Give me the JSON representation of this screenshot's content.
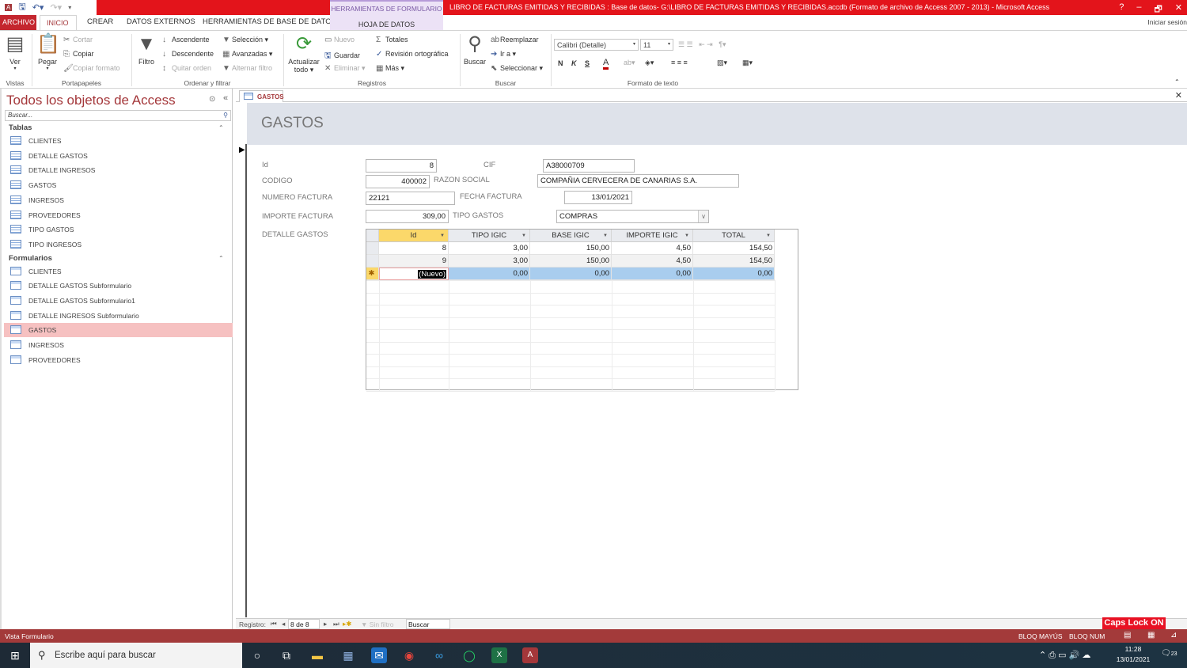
{
  "window": {
    "title": "LIBRO DE FACTURAS EMITIDAS Y RECIBIDAS : Base de datos- G:\\LIBRO DE FACTURAS EMITIDAS Y RECIBIDAS.accdb (Formato de archivo de Access 2007 - 2013) -  Microsoft Access",
    "context_tab_group": "HERRAMIENTAS DE FORMULARIO",
    "context_tab": "HOJA DE DATOS",
    "help": "?",
    "minimize": "–",
    "restore": "🗗",
    "close": "✕",
    "sign_in": "Iniciar sesión"
  },
  "tabs": [
    "ARCHIVO",
    "INICIO",
    "CREAR",
    "DATOS EXTERNOS",
    "HERRAMIENTAS DE BASE DE DATOS"
  ],
  "ribbon": {
    "vistas": {
      "label": "Vistas",
      "ver": "Ver"
    },
    "portapapeles": {
      "label": "Portapapeles",
      "pegar": "Pegar",
      "cortar": "Cortar",
      "copiar": "Copiar",
      "copiar_formato": "Copiar formato"
    },
    "ordenar": {
      "label": "Ordenar y filtrar",
      "filtro": "Filtro",
      "ascendente": "Ascendente",
      "descendente": "Descendente",
      "quitar_orden": "Quitar orden",
      "seleccion": "Selección ▾",
      "avanzadas": "Avanzadas ▾",
      "alternar_filtro": "Alternar filtro"
    },
    "registros": {
      "label": "Registros",
      "actualizar": "Actualizar",
      "todo": "todo ▾",
      "nuevo": "Nuevo",
      "guardar": "Guardar",
      "eliminar": "Eliminar ▾",
      "totales": "Totales",
      "revision": "Revisión ortográfica",
      "mas": "Más ▾"
    },
    "buscar": {
      "label": "Buscar",
      "buscar": "Buscar",
      "reemplazar": "Reemplazar",
      "ir_a": "Ir a ▾",
      "seleccionar": "Seleccionar ▾"
    },
    "formato": {
      "label": "Formato de texto",
      "font": "Calibri (Detalle)",
      "size": "11",
      "bold": "N",
      "italic": "K",
      "underline": "S",
      "font_color": "#c00000"
    }
  },
  "nav": {
    "title": "Todos los objetos de Access",
    "search_placeholder": "Buscar...",
    "groups": [
      {
        "label": "Tablas",
        "items": [
          "CLIENTES",
          "DETALLE GASTOS",
          "DETALLE INGRESOS",
          "GASTOS",
          "INGRESOS",
          "PROVEEDORES",
          "TIPO GASTOS",
          "TIPO INGRESOS"
        ]
      },
      {
        "label": "Formularios",
        "items": [
          "CLIENTES",
          "DETALLE GASTOS Subformulario",
          "DETALLE GASTOS Subformulario1",
          "DETALLE INGRESOS Subformulario",
          "GASTOS",
          "INGRESOS",
          "PROVEEDORES"
        ],
        "selected": "GASTOS"
      }
    ]
  },
  "document": {
    "tab": "GASTOS",
    "form_title": "GASTOS",
    "fields": {
      "id": {
        "label": "Id",
        "value": "8"
      },
      "cif": {
        "label": "CIF",
        "value": "A38000709"
      },
      "codigo": {
        "label": "CODIGO",
        "value": "400002"
      },
      "razon": {
        "label": "RAZON SOCIAL",
        "value": "COMPAÑIA CERVECERA DE CANARIAS S.A."
      },
      "numero": {
        "label": "NUMERO FACTURA",
        "value": "22121"
      },
      "fecha": {
        "label": "FECHA FACTURA",
        "value": "13/01/2021"
      },
      "importe": {
        "label": "IMPORTE FACTURA",
        "value": "309,00"
      },
      "tipo": {
        "label": "TIPO GASTOS",
        "value": "COMPRAS"
      }
    },
    "subform": {
      "label": "DETALLE GASTOS",
      "columns": [
        "Id",
        "TIPO IGIC",
        "BASE IGIC",
        "IMPORTE IGIC",
        "TOTAL"
      ],
      "rows": [
        [
          "8",
          "3,00",
          "150,00",
          "4,50",
          "154,50"
        ],
        [
          "9",
          "3,00",
          "150,00",
          "4,50",
          "154,50"
        ]
      ],
      "new_row": [
        "(Nuevo)",
        "0,00",
        "0,00",
        "0,00",
        "0,00"
      ]
    }
  },
  "record_nav": {
    "label": "Registro:",
    "position": "8 de 8",
    "filter": "Sin filtro",
    "search": "Buscar"
  },
  "status": {
    "view": "Vista Formulario",
    "caps": "BLOQ MAYÚS",
    "num": "BLOQ NUM",
    "caps_lock_banner": "Caps Lock ON"
  },
  "taskbar": {
    "search_placeholder": "Escribe aquí para buscar",
    "time": "11:28",
    "date": "13/01/2021",
    "notifications": "23"
  }
}
